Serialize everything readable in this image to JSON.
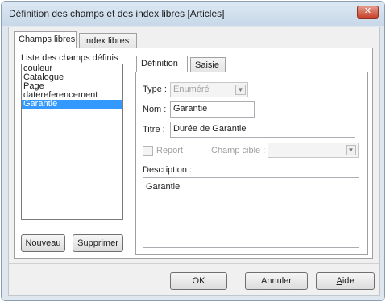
{
  "window": {
    "title": "Définition des champs et des index libres [Articles]",
    "close_glyph": "✕"
  },
  "outer_tabs": [
    {
      "label": "Champs libres",
      "active": true
    },
    {
      "label": "Index libres",
      "active": false
    }
  ],
  "fields_list": {
    "label": "Liste des champs définis",
    "items": [
      {
        "label": "couleur",
        "selected": false
      },
      {
        "label": "Catalogue",
        "selected": false
      },
      {
        "label": "Page",
        "selected": false
      },
      {
        "label": "datereferencement",
        "selected": false
      },
      {
        "label": "Garantie",
        "selected": true
      }
    ],
    "new_button": "Nouveau",
    "delete_button": "Supprimer"
  },
  "inner_tabs": [
    {
      "label": "Définition",
      "active": true
    },
    {
      "label": "Saisie",
      "active": false
    }
  ],
  "definition": {
    "type_label": "Type :",
    "type_value": "Enuméré",
    "name_label": "Nom :",
    "name_value": "Garantie",
    "title_label": "Titre :",
    "title_value": "Durée de Garantie",
    "report_label": "Report",
    "report_checked": false,
    "target_label": "Champ cible :",
    "target_value": "",
    "description_label": "Description :",
    "description_value": "Garantie"
  },
  "dialog_buttons": {
    "ok": "OK",
    "cancel": "Annuler",
    "help_underline": "A",
    "help_rest": "ide"
  },
  "icons": {
    "dropdown": "▼"
  }
}
